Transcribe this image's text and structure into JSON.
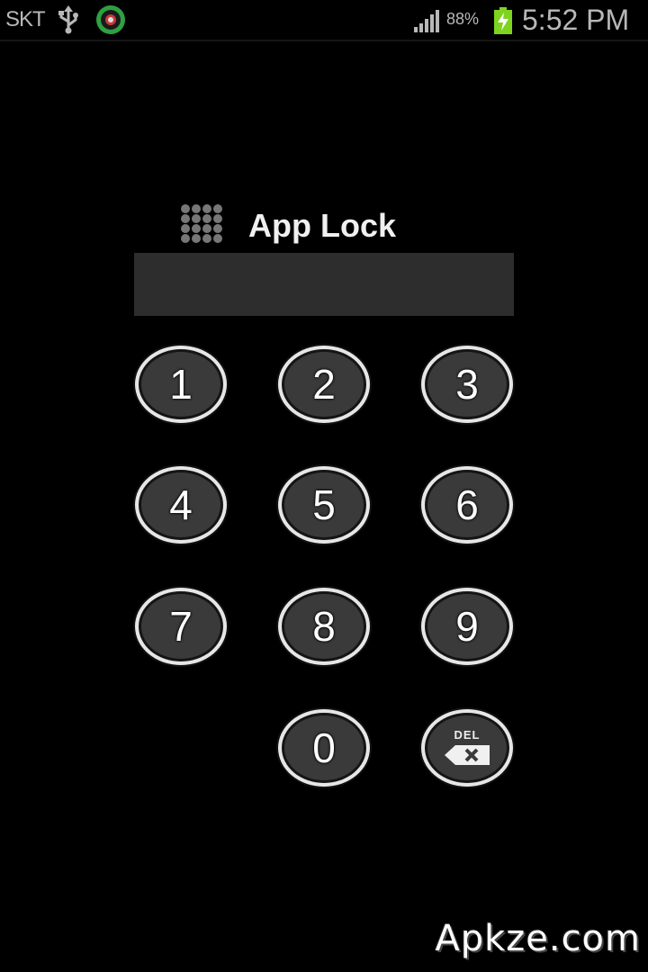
{
  "status_bar": {
    "carrier": "SKT",
    "battery_percent": "88%",
    "time": "5:52 PM",
    "icons": [
      "usb-icon",
      "app-status-icon",
      "signal-icon",
      "battery-charging-icon"
    ],
    "colors": {
      "battery": "#7ed321",
      "app_icon": "#2ea043"
    }
  },
  "app": {
    "title": "App Lock",
    "title_icon": "keypad-grid-icon"
  },
  "pin_field": {
    "value": ""
  },
  "keypad": {
    "keys": [
      "1",
      "2",
      "3",
      "4",
      "5",
      "6",
      "7",
      "8",
      "9",
      "0"
    ],
    "delete_label": "DEL",
    "delete_icon": "backspace-icon"
  },
  "watermark": "Apkze.com"
}
